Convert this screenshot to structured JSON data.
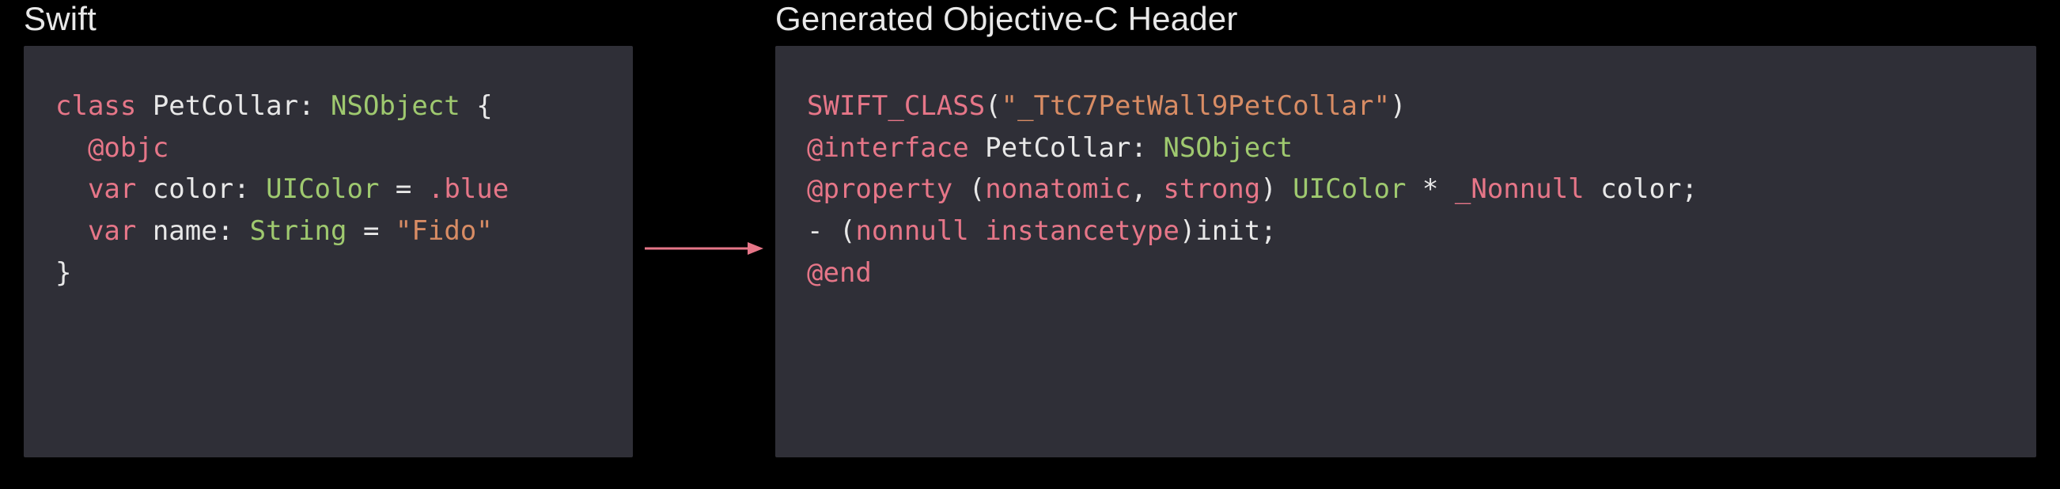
{
  "left": {
    "title": "Swift",
    "code": {
      "l1_kw": "class ",
      "l1_id": "PetCollar",
      "l1_colon": ": ",
      "l1_type": "NSObject",
      "l1_brace": " {",
      "l2_attr": "  @objc",
      "l3_kw": "  var ",
      "l3_id": "color",
      "l3_colon": ": ",
      "l3_type": "UIColor",
      "l3_eq": " = ",
      "l3_val": ".blue",
      "l4_kw": "  var ",
      "l4_id": "name",
      "l4_colon": ": ",
      "l4_type": "String",
      "l4_eq": " = ",
      "l4_str": "\"Fido\"",
      "l5_brace": "}"
    }
  },
  "right": {
    "title": "Generated Objective-C Header",
    "code": {
      "l1_macro": "SWIFT_CLASS",
      "l1_paren_open": "(",
      "l1_str": "\"_TtC7PetWall9PetCollar\"",
      "l1_paren_close": ")",
      "l2_kw": "@interface ",
      "l2_id": "PetCollar",
      "l2_colon": ": ",
      "l2_type": "NSObject",
      "l3_kw": "@property ",
      "l3_paren": "(",
      "l3_attr1": "nonatomic",
      "l3_comma": ", ",
      "l3_attr2": "strong",
      "l3_paren_close": ") ",
      "l3_type": "UIColor",
      "l3_star": " * ",
      "l3_nn": "_Nonnull ",
      "l3_id": "color",
      "l3_semi": ";",
      "l4_dash": "- ",
      "l4_paren": "(",
      "l4_nn": "nonnull ",
      "l4_inst": "instancetype",
      "l4_paren_close": ")",
      "l4_init": "init",
      "l4_semi": ";",
      "l5_end": "@end"
    }
  },
  "arrow_color": "#e67688"
}
